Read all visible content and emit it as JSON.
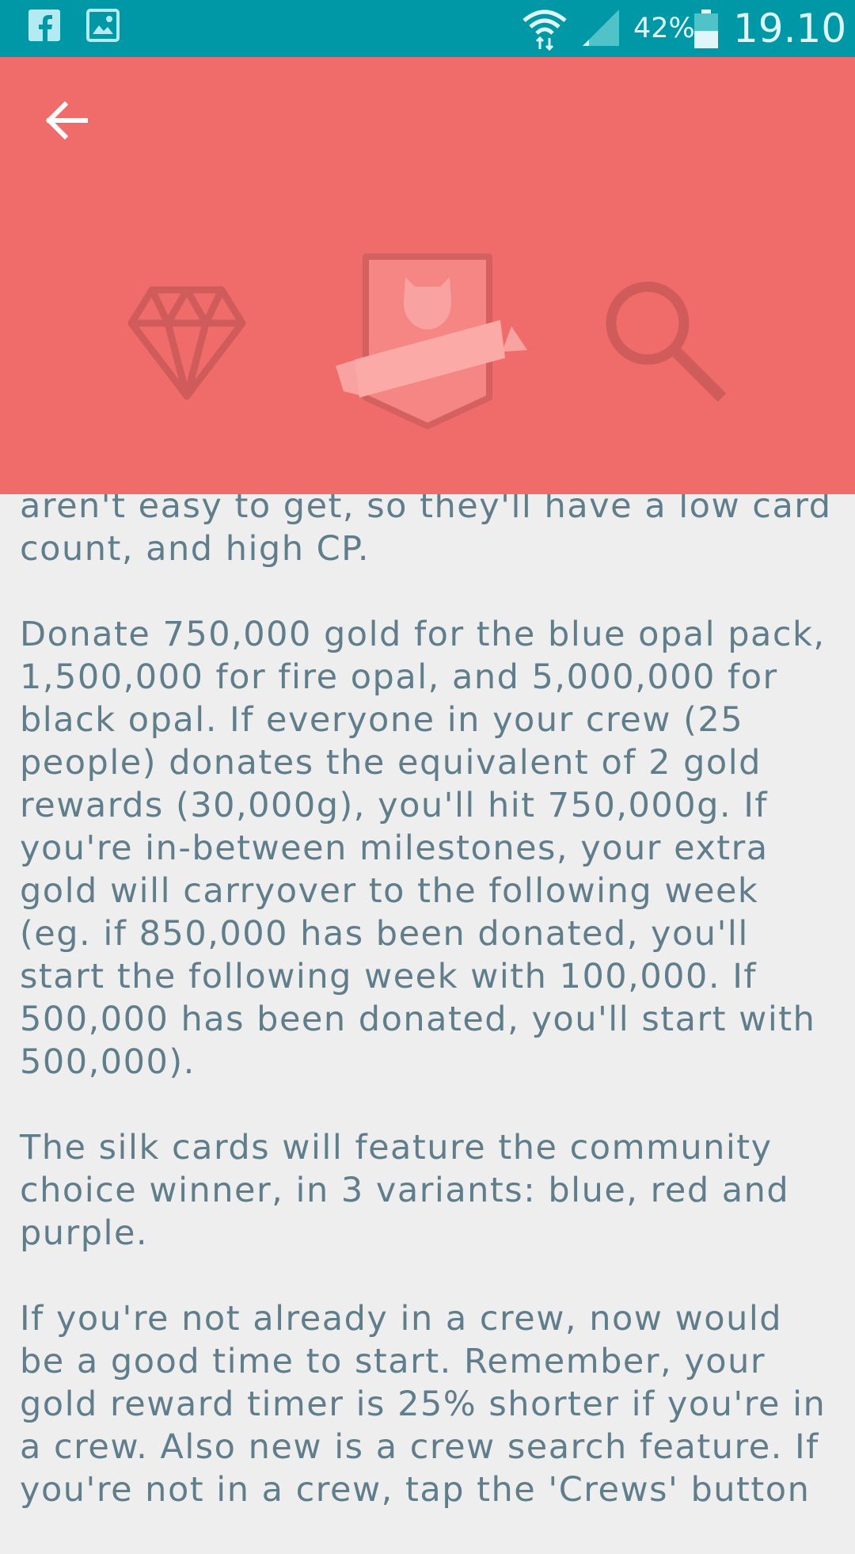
{
  "status_bar": {
    "battery_percent": "42%",
    "time": "19.10",
    "icons": [
      "facebook-icon",
      "image-icon",
      "wifi-icon",
      "signal-icon",
      "battery-icon"
    ]
  },
  "header": {
    "background_color": "#ef6c6a",
    "icons": [
      "back-arrow-icon",
      "diamond-icon",
      "crew-badge-icon",
      "search-icon"
    ]
  },
  "article": {
    "paragraphs": [
      "aren't easy to get, so they'll have a low card\ncount, and high CP.",
      "Donate 750,000 gold for the blue opal pack,\n1,500,000 for fire opal, and 5,000,000 for\nblack opal. If everyone in your crew (25\npeople) donates the equivalent of 2 gold\nrewards (30,000g), you'll hit 750,000g. If\nyou're in-between milestones, your extra\ngold will carryover to the following week\n(eg. if 850,000 has been donated, you'll\nstart the following week with 100,000. If\n500,000 has been donated, you'll start with\n500,000).",
      "The silk cards will feature the community\nchoice winner, in 3 variants: blue, red and\npurple.",
      "If you're not already in a crew, now would\nbe a good time to start. Remember, your\ngold reward timer is 25% shorter if you're in\na crew. Also new is a crew search feature. If\nyou're not in a crew, tap the 'Crews' button"
    ]
  }
}
